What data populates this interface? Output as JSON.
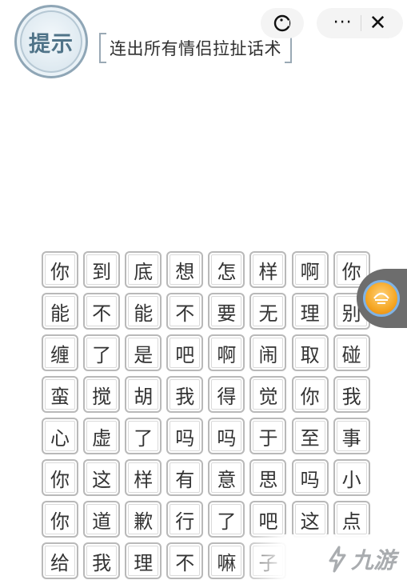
{
  "hint": {
    "label": "提示"
  },
  "task": {
    "text": "连出所有情侣拉扯话术"
  },
  "top_bar": {
    "menu_dots": "···",
    "close": "✕"
  },
  "grid": {
    "rows": [
      [
        "你",
        "到",
        "底",
        "想",
        "怎",
        "样",
        "啊",
        "你"
      ],
      [
        "能",
        "不",
        "能",
        "不",
        "要",
        "无",
        "理",
        "别"
      ],
      [
        "缠",
        "了",
        "是",
        "吧",
        "啊",
        "闹",
        "取",
        "碰"
      ],
      [
        "蛮",
        "搅",
        "胡",
        "我",
        "得",
        "觉",
        "你",
        "我"
      ],
      [
        "心",
        "虚",
        "了",
        "吗",
        "吗",
        "于",
        "至",
        "事"
      ],
      [
        "你",
        "这",
        "样",
        "有",
        "意",
        "思",
        "吗",
        "小"
      ],
      [
        "你",
        "道",
        "歉",
        "行",
        "了",
        "吧",
        "这",
        "点"
      ],
      [
        "给",
        "我",
        "理",
        "不",
        "嘛",
        "子",
        "",
        ""
      ]
    ]
  },
  "watermark": {
    "text": "九游"
  },
  "colors": {
    "accent": "#4f7388",
    "cell_border": "#b9b9b9",
    "float_bg": "#6d6d6d"
  }
}
